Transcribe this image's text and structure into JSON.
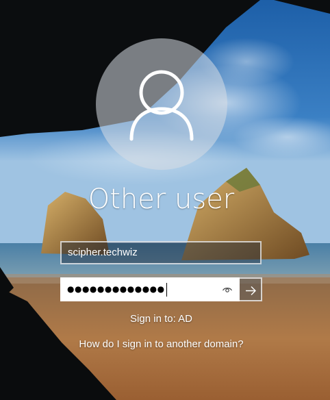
{
  "user": {
    "name": "Other user",
    "avatar_icon": "person-icon"
  },
  "username_field": {
    "value": "scipher.techwiz"
  },
  "password_field": {
    "masked_value": "●●●●●●●●●●●●●",
    "reveal_icon": "eye-icon"
  },
  "submit": {
    "icon": "arrow-right-icon"
  },
  "domain": {
    "sign_in_to": "Sign in to: AD",
    "other_domain_link": "How do I sign in to another domain?"
  },
  "colors": {
    "text": "#ffffff",
    "sky": "#2f6fb0",
    "sand": "#b07a48"
  }
}
